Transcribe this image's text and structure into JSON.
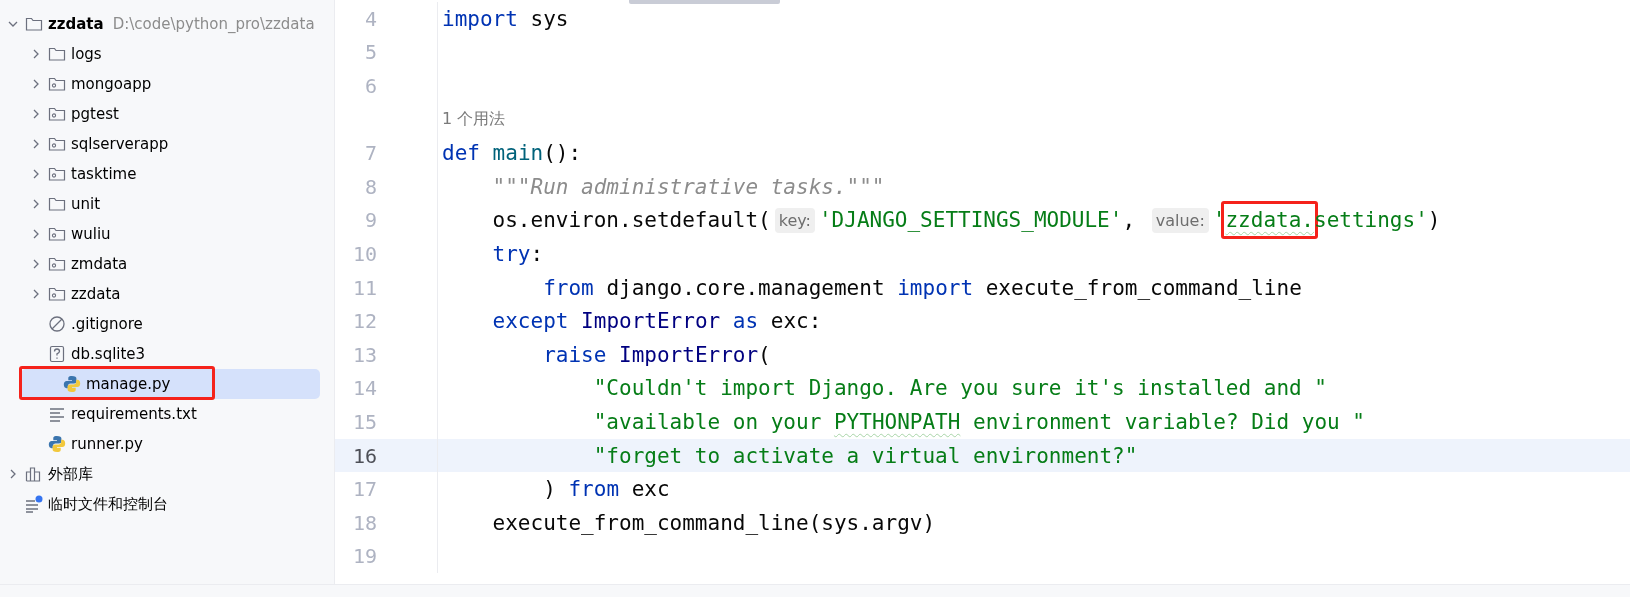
{
  "project_tree": [
    {
      "label": "zzdata",
      "path": "D:\\code\\python_pro\\zzdata",
      "kind": "folder",
      "expanded": true,
      "selected": false,
      "highlighted": false,
      "children": [
        {
          "label": "logs",
          "kind": "folder",
          "expanded": false,
          "selected": false,
          "highlighted": false
        },
        {
          "label": "mongoapp",
          "kind": "module",
          "expanded": false,
          "selected": false,
          "highlighted": false
        },
        {
          "label": "pgtest",
          "kind": "module",
          "expanded": false,
          "selected": false,
          "highlighted": false
        },
        {
          "label": "sqlserverapp",
          "kind": "module",
          "expanded": false,
          "selected": false,
          "highlighted": false
        },
        {
          "label": "tasktime",
          "kind": "module",
          "expanded": false,
          "selected": false,
          "highlighted": false
        },
        {
          "label": "unit",
          "kind": "folder",
          "expanded": false,
          "selected": false,
          "highlighted": false
        },
        {
          "label": "wuliu",
          "kind": "module",
          "expanded": false,
          "selected": false,
          "highlighted": false
        },
        {
          "label": "zmdata",
          "kind": "module",
          "expanded": false,
          "selected": false,
          "highlighted": false
        },
        {
          "label": "zzdata",
          "kind": "module",
          "expanded": false,
          "selected": false,
          "highlighted": false
        },
        {
          "label": ".gitignore",
          "kind": "ignore",
          "selected": false,
          "highlighted": false
        },
        {
          "label": "db.sqlite3",
          "kind": "unknown",
          "selected": false,
          "highlighted": false
        },
        {
          "label": "manage.py",
          "kind": "python",
          "selected": true,
          "highlighted": true
        },
        {
          "label": "requirements.txt",
          "kind": "text",
          "selected": false,
          "highlighted": false
        },
        {
          "label": "runner.py",
          "kind": "python",
          "selected": false,
          "highlighted": false
        }
      ]
    },
    {
      "label": "外部库",
      "kind": "library",
      "expanded": false,
      "selected": false,
      "highlighted": false
    },
    {
      "label": "临时文件和控制台",
      "kind": "scratch",
      "selected": false,
      "highlighted": false
    }
  ],
  "editor": {
    "lines": [
      {
        "kind": "code",
        "number": "4",
        "current": false,
        "tokens": [
          {
            "t": "import",
            "kind": "kw",
            "boxed": false,
            "warned": false
          },
          {
            "t": " sys",
            "kind": "plain",
            "boxed": false,
            "warned": false
          }
        ]
      },
      {
        "kind": "code",
        "number": "5",
        "current": false
      },
      {
        "kind": "code",
        "number": "6",
        "current": false
      },
      {
        "kind": "usage",
        "text": "1 个用法",
        "current": false
      },
      {
        "kind": "code",
        "number": "7",
        "current": false,
        "tokens": [
          {
            "t": "def",
            "kind": "kw",
            "boxed": false,
            "warned": false
          },
          {
            "t": " main",
            "kind": "fn",
            "boxed": false,
            "warned": false
          },
          {
            "t": "():",
            "kind": "plain",
            "boxed": false,
            "warned": false
          }
        ]
      },
      {
        "kind": "code",
        "number": "8",
        "current": false,
        "tokens": [
          {
            "t": "    \"\"\"Run administrative tasks.\"\"\"",
            "kind": "doc",
            "boxed": false,
            "warned": false
          }
        ]
      },
      {
        "kind": "code",
        "number": "9",
        "current": false,
        "tokens": [
          {
            "t": "    os.environ.setdefault(",
            "kind": "plain",
            "boxed": false,
            "warned": false
          },
          {
            "t": "key:",
            "kind": "hint",
            "boxed": false,
            "warned": false
          },
          {
            "t": "'DJANGO_SETTINGS_MODULE'",
            "kind": "str",
            "boxed": false,
            "warned": false
          },
          {
            "t": ",",
            "kind": "plain",
            "boxed": false,
            "warned": false
          },
          {
            "t": " value:",
            "kind": "hint",
            "boxed": false,
            "warned": false
          },
          {
            "t": "'",
            "kind": "str",
            "boxed": false,
            "warned": false
          },
          {
            "t": "zzdata.",
            "kind": "str",
            "boxed": true,
            "warned": true
          },
          {
            "t": "settings'",
            "kind": "str",
            "boxed": false,
            "warned": false
          },
          {
            "t": ")",
            "kind": "plain",
            "boxed": false,
            "warned": false
          }
        ]
      },
      {
        "kind": "code",
        "number": "10",
        "current": false,
        "tokens": [
          {
            "t": "    try",
            "kind": "kw",
            "boxed": false,
            "warned": false
          },
          {
            "t": ":",
            "kind": "plain",
            "boxed": false,
            "warned": false
          }
        ]
      },
      {
        "kind": "code",
        "number": "11",
        "current": false,
        "tokens": [
          {
            "t": "        from",
            "kind": "kw",
            "boxed": false,
            "warned": false
          },
          {
            "t": " django.core.management",
            "kind": "plain",
            "boxed": false,
            "warned": false
          },
          {
            "t": " import",
            "kind": "kw",
            "boxed": false,
            "warned": false
          },
          {
            "t": " execute_from_command_line",
            "kind": "plain",
            "boxed": false,
            "warned": false
          }
        ]
      },
      {
        "kind": "code",
        "number": "12",
        "current": false,
        "tokens": [
          {
            "t": "    except",
            "kind": "kw",
            "boxed": false,
            "warned": false
          },
          {
            "t": " ImportError",
            "kind": "cls",
            "boxed": false,
            "warned": false
          },
          {
            "t": " as",
            "kind": "kw",
            "boxed": false,
            "warned": false
          },
          {
            "t": " exc:",
            "kind": "plain",
            "boxed": false,
            "warned": false
          }
        ]
      },
      {
        "kind": "code",
        "number": "13",
        "current": false,
        "tokens": [
          {
            "t": "        raise",
            "kind": "kw",
            "boxed": false,
            "warned": false
          },
          {
            "t": " ImportError",
            "kind": "cls",
            "boxed": false,
            "warned": false
          },
          {
            "t": "(",
            "kind": "plain",
            "boxed": false,
            "warned": false
          }
        ]
      },
      {
        "kind": "code",
        "number": "14",
        "current": false,
        "tokens": [
          {
            "t": "            \"Couldn't import Django. Are you sure it's installed and \"",
            "kind": "str",
            "boxed": false,
            "warned": false
          }
        ]
      },
      {
        "kind": "code",
        "number": "15",
        "current": false,
        "tokens": [
          {
            "t": "            \"available on your",
            "kind": "str",
            "boxed": false,
            "warned": false
          },
          {
            "t": " PYTHONPATH",
            "kind": "str",
            "boxed": false,
            "warned": true
          },
          {
            "t": " environment variable? Did you \"",
            "kind": "str",
            "boxed": false,
            "warned": false
          }
        ]
      },
      {
        "kind": "code",
        "number": "16",
        "current": true,
        "tokens": [
          {
            "t": "            \"forget to activate a virtual environment?\"",
            "kind": "str",
            "boxed": false,
            "warned": false
          }
        ]
      },
      {
        "kind": "code",
        "number": "17",
        "current": false,
        "tokens": [
          {
            "t": "        )",
            "kind": "plain",
            "boxed": false,
            "warned": false
          },
          {
            "t": " from",
            "kind": "kw",
            "boxed": false,
            "warned": false
          },
          {
            "t": " exc",
            "kind": "plain",
            "boxed": false,
            "warned": false
          }
        ]
      },
      {
        "kind": "code",
        "number": "18",
        "current": false,
        "tokens": [
          {
            "t": "    execute_from_command_line(sys.argv)",
            "kind": "plain",
            "boxed": false,
            "warned": false
          }
        ]
      },
      {
        "kind": "code",
        "number": "19",
        "current": false
      }
    ]
  }
}
